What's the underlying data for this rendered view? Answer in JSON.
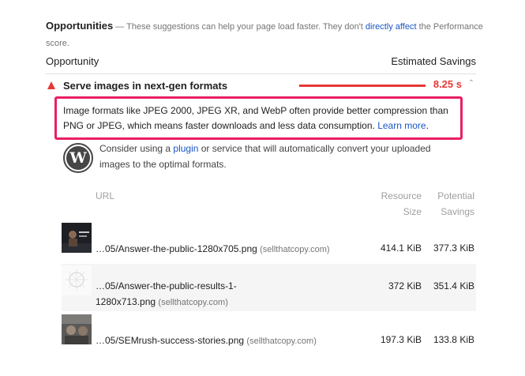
{
  "intro": {
    "heading": "Opportunities",
    "text_before": " — These suggestions can help your page load faster. They don't ",
    "link": "directly affect",
    "text_after": " the Performance score."
  },
  "columns": {
    "opportunity": "Opportunity",
    "savings": "Estimated Savings"
  },
  "audit": {
    "title": "Serve images in next-gen formats",
    "savings": "8.25 s",
    "color": "#e53935"
  },
  "description": {
    "text": "Image formats like JPEG 2000, JPEG XR, and WebP often provide better compression than PNG or JPEG, which means faster downloads and less data consumption. ",
    "link": "Learn more",
    "end": ".",
    "highlight_color": "#ea1f63"
  },
  "wordpress": {
    "logo_letter": "W",
    "before": "Consider using a ",
    "link": "plugin",
    "after": " or service that will automatically convert your uploaded images to the optimal formats."
  },
  "table": {
    "headers": {
      "url": "URL",
      "size_line1": "Resource",
      "size_line2": "Size",
      "pot_line1": "Potential",
      "pot_line2": "Savings"
    },
    "rows": [
      {
        "url_line1": "…05/Answer-the-public-1280x705.png",
        "url_line2": "",
        "host": "(sellthatcopy.com)",
        "size": "414.1 KiB",
        "savings": "377.3 KiB"
      },
      {
        "url_line1": "…05/Answer-the-public-results-1-",
        "url_line2": "1280x713.png",
        "host": "(sellthatcopy.com)",
        "size": "372 KiB",
        "savings": "351.4 KiB"
      },
      {
        "url_line1": "…05/SEMrush-success-stories.png",
        "url_line2": "",
        "host": "(sellthatcopy.com)",
        "size": "197.3 KiB",
        "savings": "133.8 KiB"
      }
    ]
  }
}
